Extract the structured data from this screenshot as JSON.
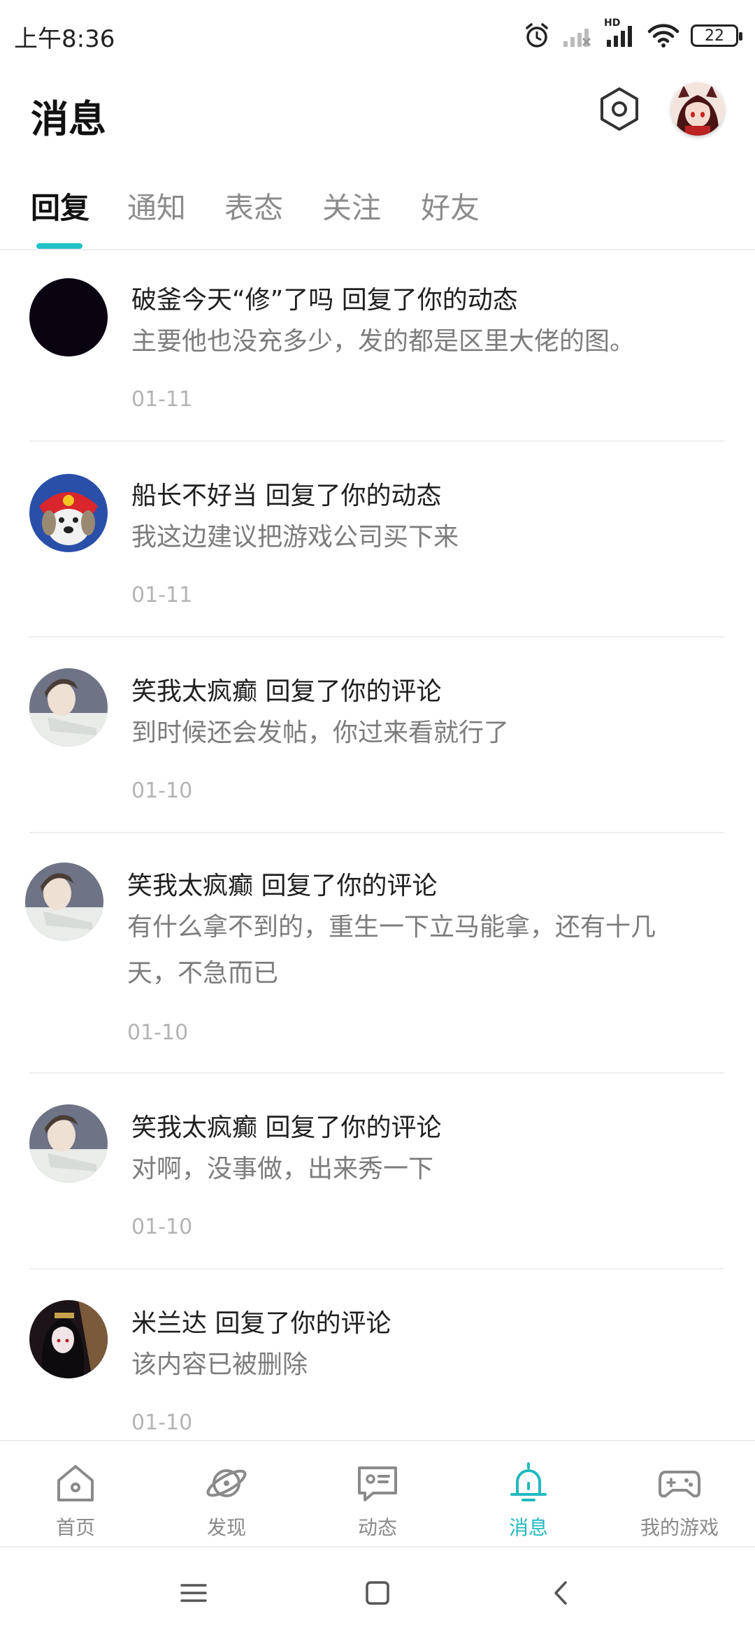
{
  "status_bar": {
    "time": "上午8:36",
    "battery": "22",
    "network_label": "HD"
  },
  "header": {
    "title": "消息"
  },
  "tabs": [
    {
      "label": "回复",
      "active": true
    },
    {
      "label": "通知",
      "active": false
    },
    {
      "label": "表态",
      "active": false
    },
    {
      "label": "关注",
      "active": false
    },
    {
      "label": "好友",
      "active": false
    }
  ],
  "messages": [
    {
      "title": "破釜今天“修”了吗 回复了你的动态",
      "content": "主要他也没充多少，发的都是区里大佬的图。",
      "date": "01-11",
      "avatar": "black-avatar"
    },
    {
      "title": "船长不好当 回复了你的动态",
      "content": "我这边建议把游戏公司买下来",
      "date": "01-11",
      "avatar": "cartoon-dog-avatar"
    },
    {
      "title": "笑我太疯癫 回复了你的评论",
      "content": "到时候还会发帖，你过来看就行了",
      "date": "01-10",
      "avatar": "anime-boy-avatar"
    },
    {
      "title": "笑我太疯癫 回复了你的评论",
      "content": "有什么拿不到的，重生一下立马能拿，还有十几天，不急而已",
      "date": "01-10",
      "avatar": "anime-boy-avatar"
    },
    {
      "title": "笑我太疯癫 回复了你的评论",
      "content": "对啊，没事做，出来秀一下",
      "date": "01-10",
      "avatar": "anime-boy-avatar"
    },
    {
      "title": "米兰达 回复了你的评论",
      "content": "该内容已被删除",
      "date": "01-10",
      "avatar": "anime-girl-avatar"
    }
  ],
  "bottom_nav": [
    {
      "label": "首页",
      "icon": "home-icon",
      "active": false
    },
    {
      "label": "发现",
      "icon": "planet-icon",
      "active": false
    },
    {
      "label": "动态",
      "icon": "chat-icon",
      "active": false
    },
    {
      "label": "消息",
      "icon": "bell-icon",
      "active": true
    },
    {
      "label": "我的游戏",
      "icon": "gamepad-icon",
      "active": false
    }
  ],
  "colors": {
    "accent": "#21c2c7",
    "text_primary": "#1f1f1f",
    "text_secondary": "#7c7c7c",
    "date": "#b3b3b3"
  }
}
